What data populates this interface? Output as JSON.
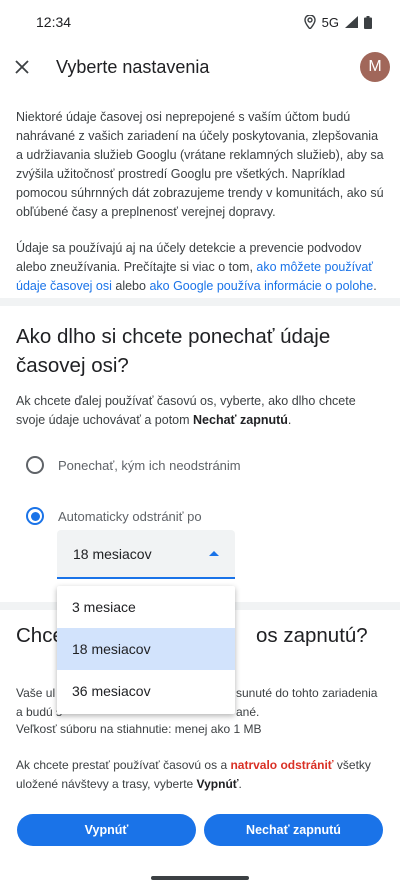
{
  "status_bar": {
    "time": "12:34",
    "network": "5G",
    "icons": [
      "location-icon",
      "signal-icon",
      "battery-icon"
    ]
  },
  "app_bar": {
    "close_icon": "close-icon",
    "title": "Vyberte nastavenia",
    "avatar_initial": "M"
  },
  "intro": {
    "para1": "Niektoré údaje časovej osi neprepojené s vaším účtom budú nahrávané z vašich zariadení na účely poskytovania, zlepšovania a udržiavania služieb Googlu (vrátane reklamných služieb), aby sa zvýšila užitočnosť prostredí Googlu pre všetkých. Napríklad pomocou súhrnných dát zobrazujeme trendy v komunitách, ako sú obľúbené časy a preplnenosť verejnej dopravy.",
    "para2_start": "Údaje sa používajú aj na účely detekcie a prevencie podvodov alebo zneužívania. Prečítajte si viac o tom, ",
    "link1": "ako môžete používať údaje časovej osi",
    "para2_mid": " alebo ",
    "link2": "ako Google používa informácie o polohe",
    "para2_end": "."
  },
  "retention": {
    "title": "Ako dlho si chcete ponechať údaje časovej osi?",
    "desc_start": "Ak chcete ďalej používať časovú os, vyberte, ako dlho chcete svoje údaje uchovávať a potom ",
    "desc_bold": "Nechať zapnutú",
    "desc_end": ".",
    "option_keep": "Ponechať, kým ich neodstránim",
    "option_auto": "Automaticky odstrániť po",
    "selected_option": "option_auto",
    "select_value": "18 mesiacov",
    "dropdown_options": [
      "3 mesiace",
      "18 mesiacov",
      "36 mesiacov"
    ],
    "dropdown_selected_index": 1
  },
  "keep_on": {
    "title_left": "Chce",
    "title_right": "os zapnutú?",
    "line1_left": "Vaše ul",
    "line1_right": "sunuté do tohto zariadenia",
    "line2_left": "a budú s",
    "line2_right": "ané.",
    "file_size": "Veľkosť súboru na stiahnutie: menej ako 1 MB",
    "stop_start": "Ak chcete prestať používať časovú os a ",
    "stop_red": "natrvalo odstrániť",
    "stop_mid": " všetky uložené návštevy a trasy, vyberte ",
    "stop_bold": "Vypnúť",
    "stop_end": "."
  },
  "buttons": {
    "turn_off": "Vypnúť",
    "keep_on": "Nechať zapnutú"
  },
  "colors": {
    "accent": "#1a73e8",
    "danger": "#d93025",
    "avatar": "#a1675a"
  }
}
